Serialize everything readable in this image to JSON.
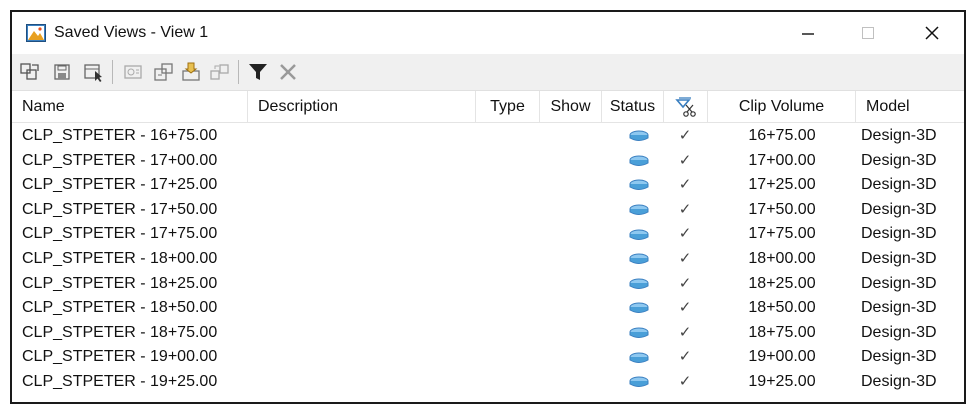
{
  "window": {
    "title": "Saved Views - View 1"
  },
  "toolbar": {
    "buttons": [
      {
        "name": "apply-view-icon"
      },
      {
        "name": "save-view-icon"
      },
      {
        "name": "select-view-icon"
      },
      {
        "name": "view-properties-icon"
      },
      {
        "name": "export-icon"
      },
      {
        "name": "import-icon"
      },
      {
        "name": "update-icon"
      },
      {
        "name": "filter-icon"
      },
      {
        "name": "delete-icon"
      }
    ]
  },
  "columns": {
    "name": "Name",
    "description": "Description",
    "type": "Type",
    "show": "Show",
    "status": "Status",
    "clip_icon": "clip-icon",
    "clip_volume": "Clip Volume",
    "model": "Model"
  },
  "rows": [
    {
      "name": "CLP_STPETER - 16+75.00",
      "clip": "16+75.00",
      "model": "Design-3D"
    },
    {
      "name": "CLP_STPETER - 17+00.00",
      "clip": "17+00.00",
      "model": "Design-3D"
    },
    {
      "name": "CLP_STPETER - 17+25.00",
      "clip": "17+25.00",
      "model": "Design-3D"
    },
    {
      "name": "CLP_STPETER - 17+50.00",
      "clip": "17+50.00",
      "model": "Design-3D"
    },
    {
      "name": "CLP_STPETER - 17+75.00",
      "clip": "17+75.00",
      "model": "Design-3D"
    },
    {
      "name": "CLP_STPETER - 18+00.00",
      "clip": "18+00.00",
      "model": "Design-3D"
    },
    {
      "name": "CLP_STPETER - 18+25.00",
      "clip": "18+25.00",
      "model": "Design-3D"
    },
    {
      "name": "CLP_STPETER - 18+50.00",
      "clip": "18+50.00",
      "model": "Design-3D"
    },
    {
      "name": "CLP_STPETER - 18+75.00",
      "clip": "18+75.00",
      "model": "Design-3D"
    },
    {
      "name": "CLP_STPETER - 19+00.00",
      "clip": "19+00.00",
      "model": "Design-3D"
    },
    {
      "name": "CLP_STPETER - 19+25.00",
      "clip": "19+25.00",
      "model": "Design-3D"
    }
  ],
  "colors": {
    "status_icon": "#4a9fd8",
    "toolbar_bg": "#f0f0f0"
  }
}
